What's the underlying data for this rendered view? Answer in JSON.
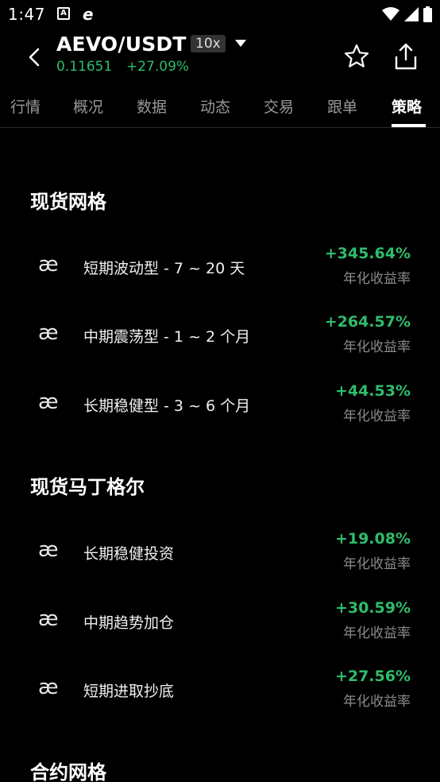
{
  "status_bar": {
    "time": "1:47",
    "icon_a": "A",
    "icon_e": "e"
  },
  "header": {
    "pair": "AEVO/USDT",
    "leverage": "10x",
    "price": "0.11651",
    "change": "+27.09%"
  },
  "tabs": [
    {
      "label": "行情"
    },
    {
      "label": "概况"
    },
    {
      "label": "数据"
    },
    {
      "label": "动态"
    },
    {
      "label": "交易"
    },
    {
      "label": "跟单"
    },
    {
      "label": "策略"
    }
  ],
  "sections": [
    {
      "title": "现货网格",
      "items": [
        {
          "icon": "æ",
          "name": "短期波动型 - 7 ~ 20 天",
          "rate": "+345.64%",
          "rate_label": "年化收益率"
        },
        {
          "icon": "æ",
          "name": "中期震荡型 - 1 ~ 2 个月",
          "rate": "+264.57%",
          "rate_label": "年化收益率"
        },
        {
          "icon": "æ",
          "name": "长期稳健型 - 3 ~ 6 个月",
          "rate": "+44.53%",
          "rate_label": "年化收益率"
        }
      ]
    },
    {
      "title": "现货马丁格尔",
      "items": [
        {
          "icon": "æ",
          "name": "长期稳健投资",
          "rate": "+19.08%",
          "rate_label": "年化收益率"
        },
        {
          "icon": "æ",
          "name": "中期趋势加仓",
          "rate": "+30.59%",
          "rate_label": "年化收益率"
        },
        {
          "icon": "æ",
          "name": "短期进取抄底",
          "rate": "+27.56%",
          "rate_label": "年化收益率"
        }
      ]
    },
    {
      "title": "合约网格",
      "items": []
    }
  ],
  "colors": {
    "positive": "#2ebd6b",
    "background": "#000000",
    "muted": "#8a8a8a"
  }
}
